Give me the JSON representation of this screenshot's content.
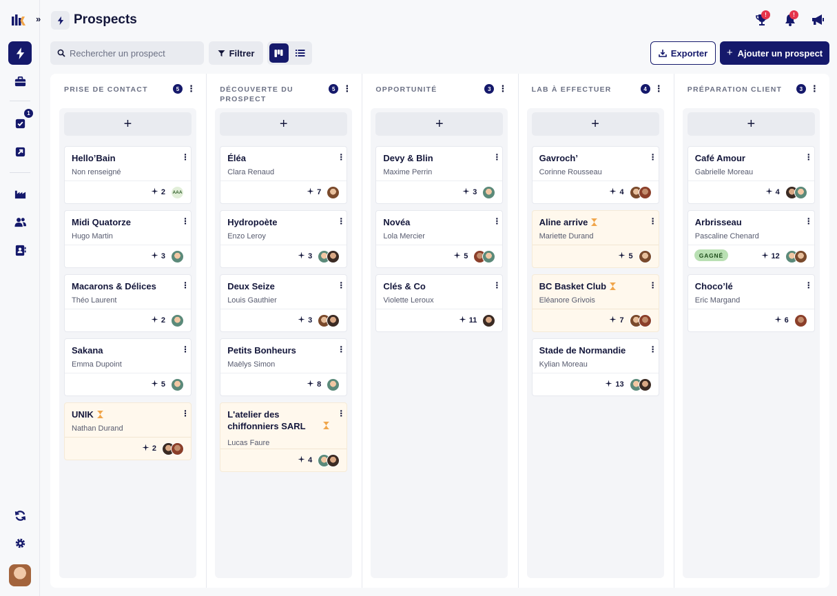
{
  "header": {
    "title": "Prospects",
    "notifications": [
      {
        "icon": "trophy-icon",
        "badge": "!"
      },
      {
        "icon": "bell-icon",
        "badge": "!"
      },
      {
        "icon": "megaphone-icon"
      }
    ]
  },
  "sidebar": {
    "items": [
      {
        "icon": "lightning-icon",
        "active": true
      },
      {
        "icon": "briefcase-icon"
      },
      {
        "icon": "checkbox-icon",
        "badge": "1"
      },
      {
        "icon": "arrow-up-right-icon"
      },
      {
        "icon": "factory-icon"
      },
      {
        "icon": "users-icon"
      },
      {
        "icon": "contact-book-icon"
      },
      {
        "icon": "refresh-icon"
      },
      {
        "icon": "gear-icon"
      }
    ],
    "task_badge": "1"
  },
  "toolbar": {
    "search_placeholder": "Rechercher un prospect",
    "filter_label": "Filtrer",
    "export_label": "Exporter",
    "add_label": "Ajouter un prospect"
  },
  "columns": [
    {
      "title": "Prise de contact",
      "count": "5",
      "cards": [
        {
          "title": "Hello’Bain",
          "subtitle": "Non renseigné",
          "count": "2",
          "avatars": [
            "initials"
          ],
          "initials": "AAA"
        },
        {
          "title": "Midi Quatorze",
          "subtitle": "Hugo Martin",
          "count": "3",
          "avatars": [
            "a3"
          ]
        },
        {
          "title": "Macarons & Délices",
          "subtitle": "Théo Laurent",
          "count": "2",
          "avatars": [
            "a3"
          ]
        },
        {
          "title": "Sakana",
          "subtitle": "Emma Dupoint",
          "count": "5",
          "avatars": [
            "a3"
          ]
        },
        {
          "title": "UNIK",
          "subtitle": "Nathan Durand",
          "count": "2",
          "avatars": [
            "a2",
            "a4"
          ],
          "pending": true
        }
      ]
    },
    {
      "title": "Découverte du prospect",
      "count": "5",
      "cards": [
        {
          "title": "Éléa",
          "subtitle": "Clara Renaud",
          "count": "7",
          "avatars": [
            "a1"
          ]
        },
        {
          "title": "Hydropoète",
          "subtitle": "Enzo Leroy",
          "count": "3",
          "avatars": [
            "a3",
            "a2"
          ]
        },
        {
          "title": "Deux Seize",
          "subtitle": "Louis Gauthier",
          "count": "3",
          "avatars": [
            "a1",
            "a2"
          ]
        },
        {
          "title": "Petits Bonheurs",
          "subtitle": "Maëlys Simon",
          "count": "8",
          "avatars": [
            "a3"
          ]
        },
        {
          "title": "L'atelier des chiffonniers SARL",
          "subtitle": "Lucas Faure",
          "count": "4",
          "avatars": [
            "a3",
            "a2"
          ],
          "pending": true
        }
      ]
    },
    {
      "title": "Opportunité",
      "count": "3",
      "cards": [
        {
          "title": "Devy & Blin",
          "subtitle": "Maxime Perrin",
          "count": "3",
          "avatars": [
            "a3"
          ]
        },
        {
          "title": "Novéa",
          "subtitle": "Lola Mercier",
          "count": "5",
          "avatars": [
            "a4",
            "a3"
          ]
        },
        {
          "title": "Clés & Co",
          "subtitle": "Violette Leroux",
          "count": "11",
          "avatars": [
            "a2"
          ]
        }
      ]
    },
    {
      "title": "Lab à effectuer",
      "count": "4",
      "cards": [
        {
          "title": "Gavroch’",
          "subtitle": "Corinne Rousseau",
          "count": "4",
          "avatars": [
            "a1",
            "a4"
          ]
        },
        {
          "title": "Aline arrive",
          "subtitle": "Mariette Durand",
          "count": "5",
          "avatars": [
            "a1"
          ],
          "pending": true
        },
        {
          "title": "BC Basket Club",
          "subtitle": "Eléanore Grivois",
          "count": "7",
          "avatars": [
            "a1",
            "a4"
          ],
          "pending": true
        },
        {
          "title": "Stade de Normandie",
          "subtitle": "Kylian Moreau",
          "count": "13",
          "avatars": [
            "a3",
            "a2"
          ]
        }
      ]
    },
    {
      "title": "Préparation client",
      "count": "3",
      "cards": [
        {
          "title": "Café Amour",
          "subtitle": "Gabrielle Moreau",
          "count": "4",
          "avatars": [
            "a2",
            "a3"
          ]
        },
        {
          "title": "Arbrisseau",
          "subtitle": "Pascaline Chenard",
          "count": "12",
          "avatars": [
            "a3",
            "a1"
          ],
          "badge": "GAGNÉ"
        },
        {
          "title": "Choco’lé",
          "subtitle": "Eric Margand",
          "count": "6",
          "avatars": [
            "a4"
          ]
        }
      ]
    }
  ],
  "colors": {
    "primary": "#15196b",
    "alert": "#e5344b",
    "pending_bg": "#fff8ed",
    "won_bg": "#b9e0b3",
    "hourglass": "#f0a54a"
  }
}
